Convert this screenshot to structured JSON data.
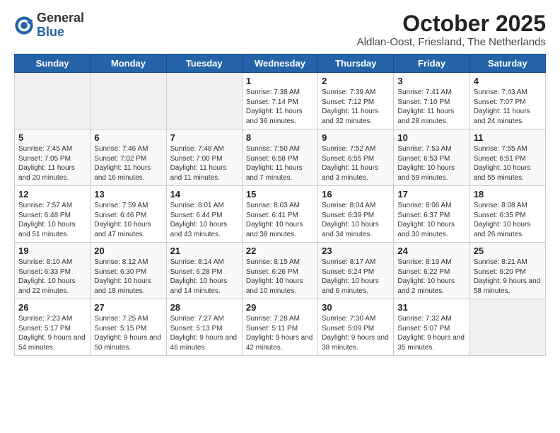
{
  "header": {
    "logo_general": "General",
    "logo_blue": "Blue",
    "month_title": "October 2025",
    "location": "Aldlan-Oost, Friesland, The Netherlands"
  },
  "days_of_week": [
    "Sunday",
    "Monday",
    "Tuesday",
    "Wednesday",
    "Thursday",
    "Friday",
    "Saturday"
  ],
  "weeks": [
    [
      {
        "day": "",
        "empty": true
      },
      {
        "day": "",
        "empty": true
      },
      {
        "day": "",
        "empty": true
      },
      {
        "day": "1",
        "sunrise": "7:38 AM",
        "sunset": "7:14 PM",
        "daylight": "11 hours and 36 minutes."
      },
      {
        "day": "2",
        "sunrise": "7:39 AM",
        "sunset": "7:12 PM",
        "daylight": "11 hours and 32 minutes."
      },
      {
        "day": "3",
        "sunrise": "7:41 AM",
        "sunset": "7:10 PM",
        "daylight": "11 hours and 28 minutes."
      },
      {
        "day": "4",
        "sunrise": "7:43 AM",
        "sunset": "7:07 PM",
        "daylight": "11 hours and 24 minutes."
      }
    ],
    [
      {
        "day": "5",
        "sunrise": "7:45 AM",
        "sunset": "7:05 PM",
        "daylight": "11 hours and 20 minutes."
      },
      {
        "day": "6",
        "sunrise": "7:46 AM",
        "sunset": "7:02 PM",
        "daylight": "11 hours and 16 minutes."
      },
      {
        "day": "7",
        "sunrise": "7:48 AM",
        "sunset": "7:00 PM",
        "daylight": "11 hours and 11 minutes."
      },
      {
        "day": "8",
        "sunrise": "7:50 AM",
        "sunset": "6:58 PM",
        "daylight": "11 hours and 7 minutes."
      },
      {
        "day": "9",
        "sunrise": "7:52 AM",
        "sunset": "6:55 PM",
        "daylight": "11 hours and 3 minutes."
      },
      {
        "day": "10",
        "sunrise": "7:53 AM",
        "sunset": "6:53 PM",
        "daylight": "10 hours and 59 minutes."
      },
      {
        "day": "11",
        "sunrise": "7:55 AM",
        "sunset": "6:51 PM",
        "daylight": "10 hours and 55 minutes."
      }
    ],
    [
      {
        "day": "12",
        "sunrise": "7:57 AM",
        "sunset": "6:48 PM",
        "daylight": "10 hours and 51 minutes."
      },
      {
        "day": "13",
        "sunrise": "7:59 AM",
        "sunset": "6:46 PM",
        "daylight": "10 hours and 47 minutes."
      },
      {
        "day": "14",
        "sunrise": "8:01 AM",
        "sunset": "6:44 PM",
        "daylight": "10 hours and 43 minutes."
      },
      {
        "day": "15",
        "sunrise": "8:03 AM",
        "sunset": "6:41 PM",
        "daylight": "10 hours and 38 minutes."
      },
      {
        "day": "16",
        "sunrise": "8:04 AM",
        "sunset": "6:39 PM",
        "daylight": "10 hours and 34 minutes."
      },
      {
        "day": "17",
        "sunrise": "8:06 AM",
        "sunset": "6:37 PM",
        "daylight": "10 hours and 30 minutes."
      },
      {
        "day": "18",
        "sunrise": "8:08 AM",
        "sunset": "6:35 PM",
        "daylight": "10 hours and 26 minutes."
      }
    ],
    [
      {
        "day": "19",
        "sunrise": "8:10 AM",
        "sunset": "6:33 PM",
        "daylight": "10 hours and 22 minutes."
      },
      {
        "day": "20",
        "sunrise": "8:12 AM",
        "sunset": "6:30 PM",
        "daylight": "10 hours and 18 minutes."
      },
      {
        "day": "21",
        "sunrise": "8:14 AM",
        "sunset": "6:28 PM",
        "daylight": "10 hours and 14 minutes."
      },
      {
        "day": "22",
        "sunrise": "8:15 AM",
        "sunset": "6:26 PM",
        "daylight": "10 hours and 10 minutes."
      },
      {
        "day": "23",
        "sunrise": "8:17 AM",
        "sunset": "6:24 PM",
        "daylight": "10 hours and 6 minutes."
      },
      {
        "day": "24",
        "sunrise": "8:19 AM",
        "sunset": "6:22 PM",
        "daylight": "10 hours and 2 minutes."
      },
      {
        "day": "25",
        "sunrise": "8:21 AM",
        "sunset": "6:20 PM",
        "daylight": "9 hours and 58 minutes."
      }
    ],
    [
      {
        "day": "26",
        "sunrise": "7:23 AM",
        "sunset": "5:17 PM",
        "daylight": "9 hours and 54 minutes."
      },
      {
        "day": "27",
        "sunrise": "7:25 AM",
        "sunset": "5:15 PM",
        "daylight": "9 hours and 50 minutes."
      },
      {
        "day": "28",
        "sunrise": "7:27 AM",
        "sunset": "5:13 PM",
        "daylight": "9 hours and 46 minutes."
      },
      {
        "day": "29",
        "sunrise": "7:28 AM",
        "sunset": "5:11 PM",
        "daylight": "9 hours and 42 minutes."
      },
      {
        "day": "30",
        "sunrise": "7:30 AM",
        "sunset": "5:09 PM",
        "daylight": "9 hours and 38 minutes."
      },
      {
        "day": "31",
        "sunrise": "7:32 AM",
        "sunset": "5:07 PM",
        "daylight": "9 hours and 35 minutes."
      },
      {
        "day": "",
        "empty": true
      }
    ]
  ]
}
